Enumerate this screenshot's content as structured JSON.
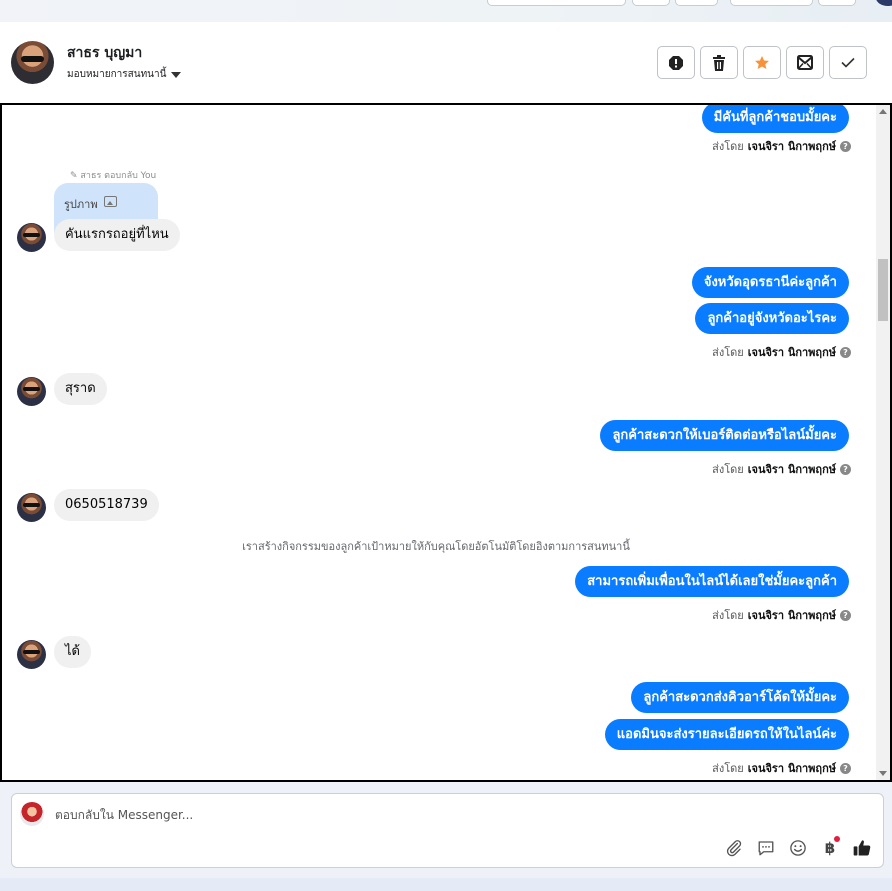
{
  "header": {
    "contact_name": "สาธร บุญมา",
    "assign_label": "มอบหมายการสนทนานี้",
    "actions": [
      {
        "name": "spam-icon"
      },
      {
        "name": "trash-icon"
      },
      {
        "name": "star-icon"
      },
      {
        "name": "mail-icon"
      },
      {
        "name": "check-icon"
      }
    ]
  },
  "colors": {
    "outgoing": "#0a7cff",
    "incoming": "#f0f0f0",
    "star": "#f7923a"
  },
  "conversation": {
    "sent_by_prefix": "ส่งโดย",
    "agent_name": "เจนจิรา นิกาพฤกษ์",
    "reply_note": "สาธร ตอบกลับ You",
    "reply_quote": "รูปภาพ",
    "messages": {
      "m1": "มีคันที่ลูกค้าชอบมั้ยคะ",
      "m2": "คันแรกรถอยู่ที่ไหน",
      "m3": "จังหวัดอุดรธานีค่ะลูกค้า",
      "m4": "ลูกค้าอยู่จังหวัดอะไรคะ",
      "m5": "สุราด",
      "m6": "ลูกค้าสะดวกให้เบอร์ติดต่อหรือไลน์มั้ยคะ",
      "m7": "0650518739",
      "system": "เราสร้างกิจกรรมของลูกค้าเป้าหมายให้กับคุณโดยอัตโนมัติโดยอิงตามการสนทนานี้",
      "m8": "สามารถเพิ่มเพื่อนในไลน์ได้เลยใช่มั้ยคะลูกค้า",
      "m9": "ได้",
      "m10": "ลูกค้าสะดวกส่งคิวอาร์โค้ดให้มั้ยคะ",
      "m11": "แอดมินจะส่งรายละเอียดรถให้ในไลน์ค่ะ"
    }
  },
  "composer": {
    "placeholder": "ตอบกลับใน Messenger...",
    "tools": [
      "paperclip-icon",
      "saved-reply-icon",
      "emoji-icon",
      "baht-icon",
      "thumbs-up-icon"
    ],
    "baht_symbol": "฿"
  }
}
